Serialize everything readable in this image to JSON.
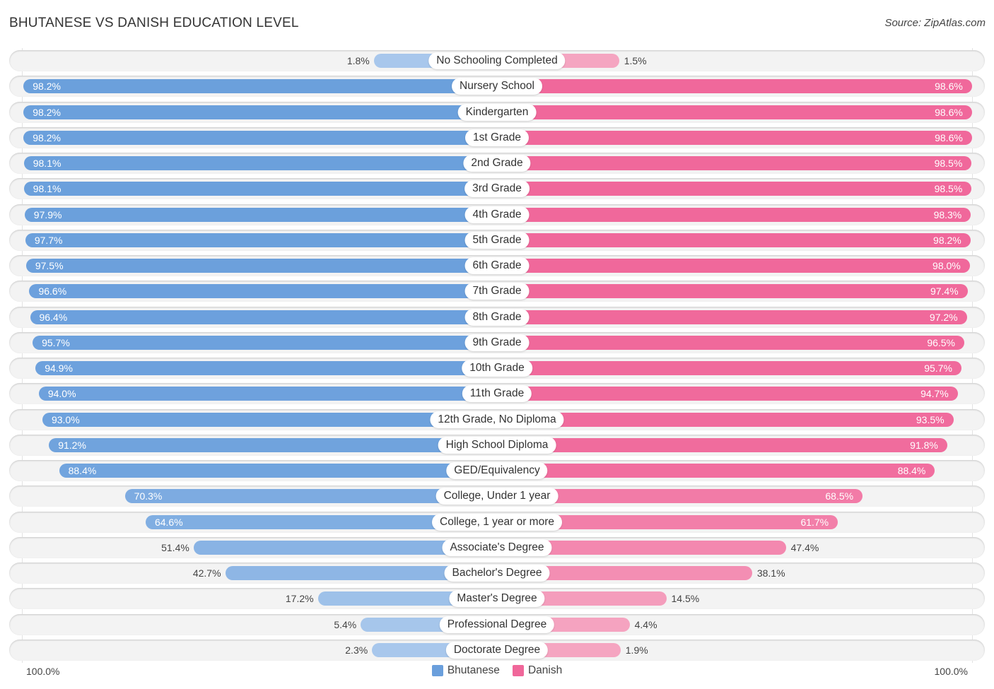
{
  "title": "BHUTANESE VS DANISH EDUCATION LEVEL",
  "source": "Source: ZipAtlas.com",
  "colors": {
    "bhutanese": "#6a9fdc",
    "bhutanese_light": "#a9c8ec",
    "danish": "#f0679a",
    "danish_light": "#f5a6c2"
  },
  "chart_data": {
    "type": "bar",
    "orientation": "horizontal-diverging",
    "title": "BHUTANESE VS DANISH EDUCATION LEVEL",
    "categories": [
      "No Schooling Completed",
      "Nursery School",
      "Kindergarten",
      "1st Grade",
      "2nd Grade",
      "3rd Grade",
      "4th Grade",
      "5th Grade",
      "6th Grade",
      "7th Grade",
      "8th Grade",
      "9th Grade",
      "10th Grade",
      "11th Grade",
      "12th Grade, No Diploma",
      "High School Diploma",
      "GED/Equivalency",
      "College, Under 1 year",
      "College, 1 year or more",
      "Associate's Degree",
      "Bachelor's Degree",
      "Master's Degree",
      "Professional Degree",
      "Doctorate Degree"
    ],
    "series": [
      {
        "name": "Bhutanese",
        "side": "left",
        "values": [
          1.8,
          98.2,
          98.2,
          98.2,
          98.1,
          98.1,
          97.9,
          97.7,
          97.5,
          96.6,
          96.4,
          95.7,
          94.9,
          94.0,
          93.0,
          91.2,
          88.4,
          70.3,
          64.6,
          51.4,
          42.7,
          17.2,
          5.4,
          2.3
        ],
        "labels": [
          "1.8%",
          "98.2%",
          "98.2%",
          "98.2%",
          "98.1%",
          "98.1%",
          "97.9%",
          "97.7%",
          "97.5%",
          "96.6%",
          "96.4%",
          "95.7%",
          "94.9%",
          "94.0%",
          "93.0%",
          "91.2%",
          "88.4%",
          "70.3%",
          "64.6%",
          "51.4%",
          "42.7%",
          "17.2%",
          "5.4%",
          "2.3%"
        ]
      },
      {
        "name": "Danish",
        "side": "right",
        "values": [
          1.5,
          98.6,
          98.6,
          98.6,
          98.5,
          98.5,
          98.3,
          98.2,
          98.0,
          97.4,
          97.2,
          96.5,
          95.7,
          94.7,
          93.5,
          91.8,
          88.4,
          68.5,
          61.7,
          47.4,
          38.1,
          14.5,
          4.4,
          1.9
        ],
        "labels": [
          "1.5%",
          "98.6%",
          "98.6%",
          "98.6%",
          "98.5%",
          "98.5%",
          "98.3%",
          "98.2%",
          "98.0%",
          "97.4%",
          "97.2%",
          "96.5%",
          "95.7%",
          "94.7%",
          "93.5%",
          "91.8%",
          "88.4%",
          "68.5%",
          "61.7%",
          "47.4%",
          "38.1%",
          "14.5%",
          "4.4%",
          "1.9%"
        ]
      }
    ],
    "xlim": [
      0,
      100
    ],
    "axis_labels": {
      "left": "100.0%",
      "right": "100.0%"
    },
    "legend": {
      "position": "bottom-center",
      "entries": [
        "Bhutanese",
        "Danish"
      ]
    }
  }
}
